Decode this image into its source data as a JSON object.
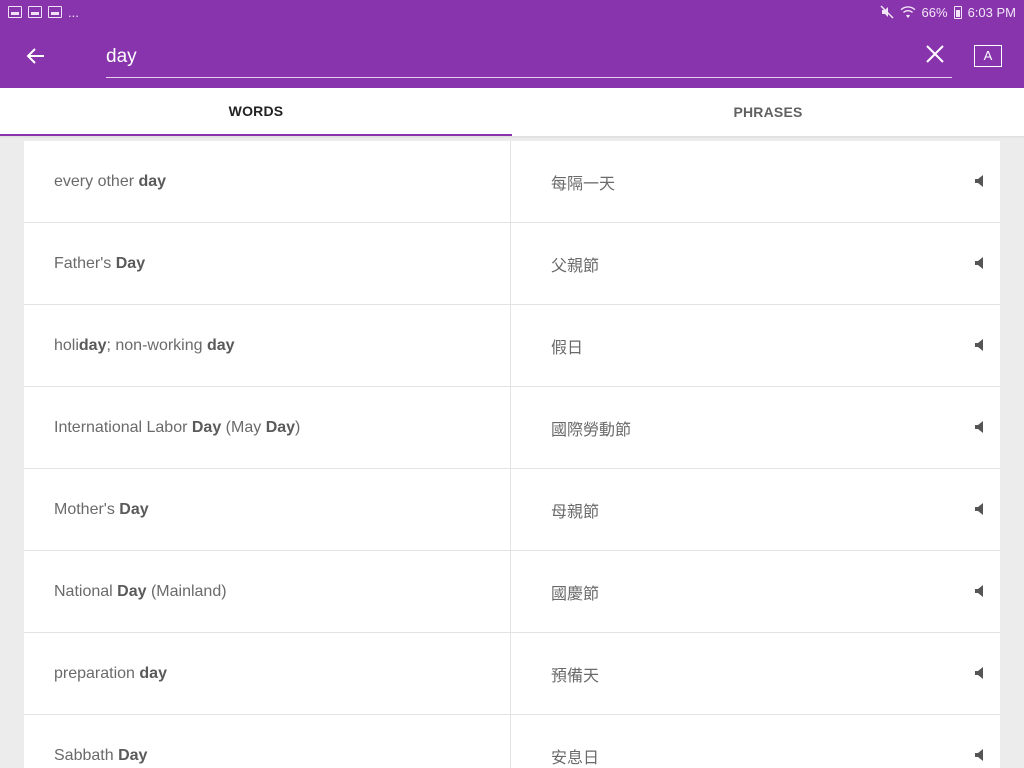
{
  "status_bar": {
    "left_icons": [
      "image-icon",
      "calendar-icon",
      "gallery-icon"
    ],
    "overflow": "...",
    "mute_icon": "mute-icon",
    "wifi_icon": "wifi-icon",
    "battery_text": "66%",
    "time": "6:03 PM"
  },
  "app_bar": {
    "back_icon": "back-arrow-icon",
    "search_value": "day",
    "clear_icon": "close-icon",
    "keyboard_label": "A"
  },
  "tabs": [
    {
      "label": "WORDS",
      "active": true
    },
    {
      "label": "PHRASES",
      "active": false
    }
  ],
  "results": [
    {
      "term_parts": [
        {
          "t": "every other "
        },
        {
          "t": "day",
          "b": true
        }
      ],
      "translation": "每隔一天"
    },
    {
      "term_parts": [
        {
          "t": "Father's "
        },
        {
          "t": "Day",
          "b": true
        }
      ],
      "translation": "父親節"
    },
    {
      "term_parts": [
        {
          "t": "holi"
        },
        {
          "t": "day",
          "b": true
        },
        {
          "t": "; non-working "
        },
        {
          "t": "day",
          "b": true
        }
      ],
      "translation": "假日"
    },
    {
      "term_parts": [
        {
          "t": "International Labor "
        },
        {
          "t": "Day",
          "b": true
        },
        {
          "t": " (May "
        },
        {
          "t": "Day",
          "b": true
        },
        {
          "t": ")"
        }
      ],
      "translation": "國際勞動節"
    },
    {
      "term_parts": [
        {
          "t": "Mother's "
        },
        {
          "t": "Day",
          "b": true
        }
      ],
      "translation": "母親節"
    },
    {
      "term_parts": [
        {
          "t": "National "
        },
        {
          "t": "Day",
          "b": true
        },
        {
          "t": " (Mainland)"
        }
      ],
      "translation": "國慶節"
    },
    {
      "term_parts": [
        {
          "t": "preparation "
        },
        {
          "t": "day",
          "b": true
        }
      ],
      "translation": "預備天"
    },
    {
      "term_parts": [
        {
          "t": "Sabbath "
        },
        {
          "t": "Day",
          "b": true
        }
      ],
      "translation": "安息日"
    }
  ],
  "colors": {
    "primary": "#8835ad",
    "list_bg": "#ececec",
    "row_bg": "#ffffff"
  }
}
